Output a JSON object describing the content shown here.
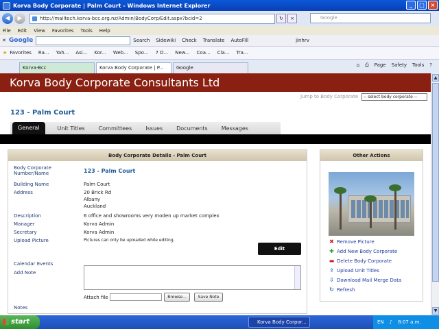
{
  "window": {
    "title": "Korva Body Corporate | Palm Court - Windows Internet Explorer",
    "address": "http://mailtech.korva-bcc.org.nz/Admin/BodyCorp/Edit.aspx?bcid=2",
    "search_placeholder": "Google"
  },
  "menu": [
    "File",
    "Edit",
    "View",
    "Favorites",
    "Tools",
    "Help"
  ],
  "google_toolbar": {
    "logo": "Google",
    "tools": [
      "Search",
      "Sidewiki",
      "Check",
      "Translate",
      "AutoFill",
      "jinhrv"
    ]
  },
  "favorites": {
    "label": "Favorites",
    "items": [
      "Ra...",
      "Yah...",
      "Asi...",
      "Kor...",
      "Web...",
      "Spo...",
      "7 D...",
      "New...",
      "Coa...",
      "Cla...",
      "Tra..."
    ]
  },
  "tabs": [
    "Korva-Bcc",
    "Korva Body Corporate | P...",
    "Google"
  ],
  "ie_tools": [
    "Page",
    "Safety",
    "Tools"
  ],
  "site": {
    "banner": "Korva Body Corporate Consultants Ltd",
    "jump_label": "Jump to Body Corporate",
    "jump_value": "-- select body corporate --",
    "page_title": "123 - Palm Court",
    "nav": [
      "General",
      "Unit Titles",
      "Committees",
      "Issues",
      "Documents",
      "Messages"
    ]
  },
  "details": {
    "header": "Body Corporate Details - Palm Court",
    "fields": [
      {
        "label": "Body Corporate Number/Name",
        "value": "123 - Palm Court"
      },
      {
        "label": "Building Name",
        "value": "Palm Court"
      },
      {
        "label": "Address",
        "value": "20 Brick Rd"
      },
      {
        "label": "",
        "value": "Albany"
      },
      {
        "label": "",
        "value": "Auckland"
      },
      {
        "label": "Description",
        "value": "6 office and showrooms very moden up market complex"
      },
      {
        "label": "Manager",
        "value": "Korva Admin"
      },
      {
        "label": "Secretary",
        "value": "Korva Admin"
      },
      {
        "label": "Upload Picture",
        "value": "Pictures can only be uploaded while editing."
      }
    ],
    "edit_label": "Edit",
    "calendar_label": "Calendar Events",
    "add_note_label": "Add Note",
    "attach_label": "Attach file",
    "browse_label": "Browse...",
    "save_note_label": "Save Note",
    "notes_label": "Notes"
  },
  "other_actions": {
    "header": "Other Actions",
    "items": [
      {
        "label": "Remove Picture",
        "icon": "remove-icon",
        "color": "#d02020"
      },
      {
        "label": "Add New Body Corporate",
        "icon": "add-icon",
        "color": "#2e9e2e"
      },
      {
        "label": "Delete Body Corporate",
        "icon": "delete-icon",
        "color": "#d02020"
      },
      {
        "label": "Upload Unit Titles",
        "icon": "upload-icon",
        "color": "#3a6ac0"
      },
      {
        "label": "Download Mail Merge Data",
        "icon": "download-icon",
        "color": "#3a6ac0"
      },
      {
        "label": "Refresh",
        "icon": "refresh-icon",
        "color": "#3a6ac0"
      }
    ]
  },
  "taskbar": {
    "start": "start",
    "task": "Korva Body Corpor...",
    "lang": "EN",
    "time": "8:07 a.m."
  },
  "colors": {
    "banner": "#8a2011",
    "title": "#1e5b96"
  }
}
